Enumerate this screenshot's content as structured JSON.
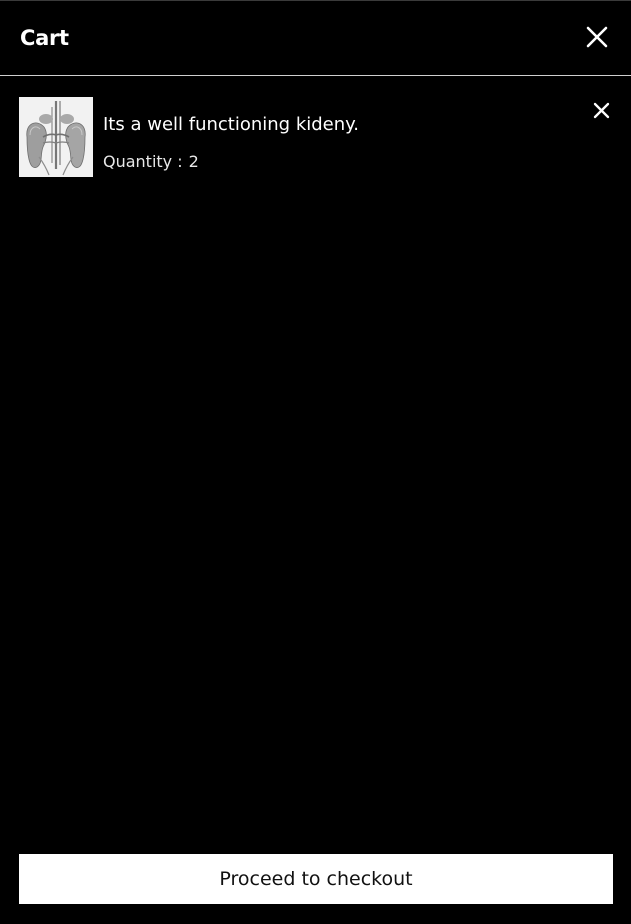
{
  "cart": {
    "title": "Cart",
    "close_icon": "close-icon"
  },
  "items": [
    {
      "image_icon": "kidney-organ-illustration",
      "description": "Its a well functioning kideny.",
      "quantity_label": "Quantity :",
      "quantity": "2",
      "remove_icon": "close-icon"
    }
  ],
  "footer": {
    "checkout_label": "Proceed to checkout"
  },
  "colors": {
    "background": "#000000",
    "text": "#ffffff",
    "divider": "#cfcfcf",
    "button_bg": "#ffffff",
    "button_text": "#111111"
  }
}
